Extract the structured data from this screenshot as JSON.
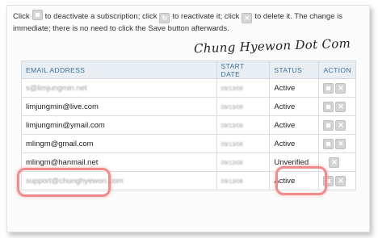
{
  "instructions": {
    "part1": "Click",
    "part2": "to deactivate a subscription; click",
    "part3": "to reactivate it; click",
    "part4": "to delete it. The change is immediate; there is no need to click the Save button afterwards."
  },
  "watermark": "Chung Hyewon Dot Com",
  "table": {
    "headers": [
      "EMAIL ADDRESS",
      "START DATE",
      "STATUS",
      "ACTION"
    ],
    "rows": [
      {
        "email": "s@limjungmin.net",
        "date": "09/13/08",
        "status": "Active"
      },
      {
        "email": "limjungmin@live.com",
        "date": "09/13/08",
        "status": "Active"
      },
      {
        "email": "limjungmin@ymail.com",
        "date": "09/13/08",
        "status": "Active"
      },
      {
        "email": "mlingm@gmail.com",
        "date": "09/13/08",
        "status": "Active"
      },
      {
        "email": "mlingm@hanmail.net",
        "date": "09/13/08",
        "status": "Unverified"
      },
      {
        "email": "support@chunghyewon.com",
        "date": "09/13/08",
        "status": "Active"
      }
    ]
  },
  "colors": {
    "header_text": "#3a6e9a",
    "header_bg": "#e9eef3",
    "highlight": "#f48a8a"
  }
}
